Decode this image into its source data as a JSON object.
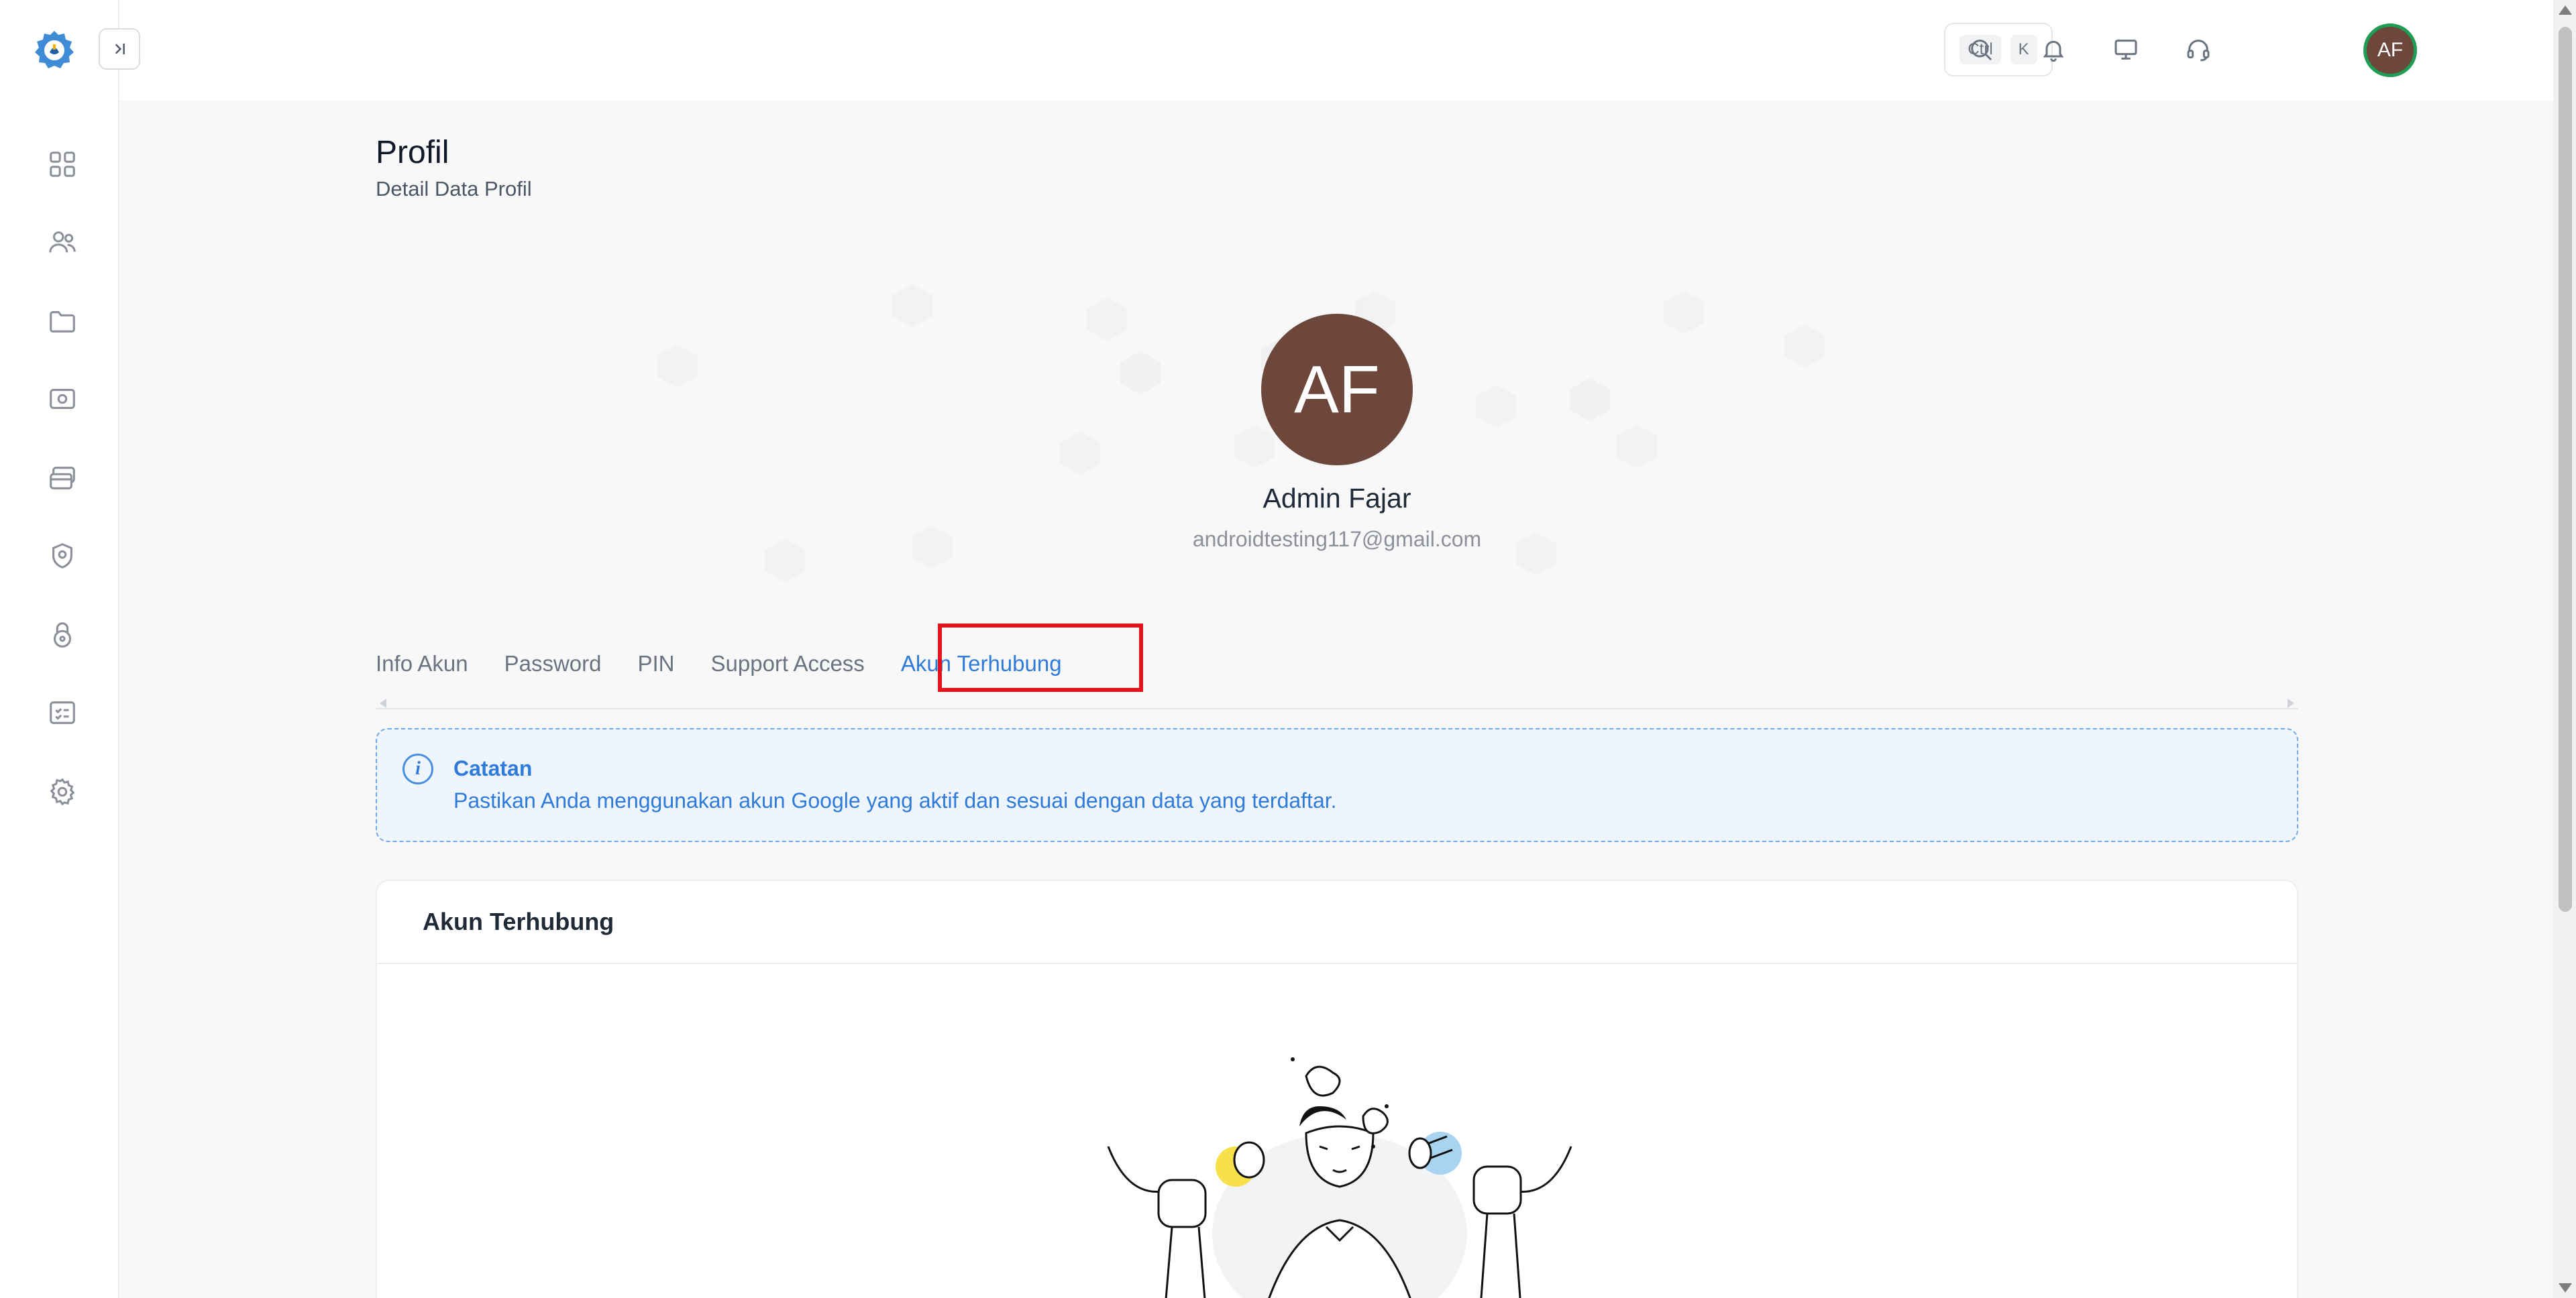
{
  "header": {
    "shortcut_ctrl": "Ctrl",
    "shortcut_k": "K",
    "avatar_initials": "AF"
  },
  "page": {
    "title": "Profil",
    "subtitle": "Detail Data Profil"
  },
  "profile": {
    "initials": "AF",
    "name": "Admin Fajar",
    "email": "androidtesting117@gmail.com"
  },
  "tabs": [
    {
      "label": "Info Akun"
    },
    {
      "label": "Password"
    },
    {
      "label": "PIN"
    },
    {
      "label": "Support Access"
    },
    {
      "label": "Akun Terhubung",
      "active": true
    }
  ],
  "alert": {
    "title": "Catatan",
    "text": "Pastikan Anda menggunakan akun Google yang aktif dan sesuai dengan data yang terdaftar."
  },
  "card": {
    "title": "Akun Terhubung"
  },
  "colors": {
    "accent": "#2f7bd9",
    "avatar": "#6d473b",
    "highlight": "#e3141e",
    "online_ring": "#1f9d55"
  }
}
